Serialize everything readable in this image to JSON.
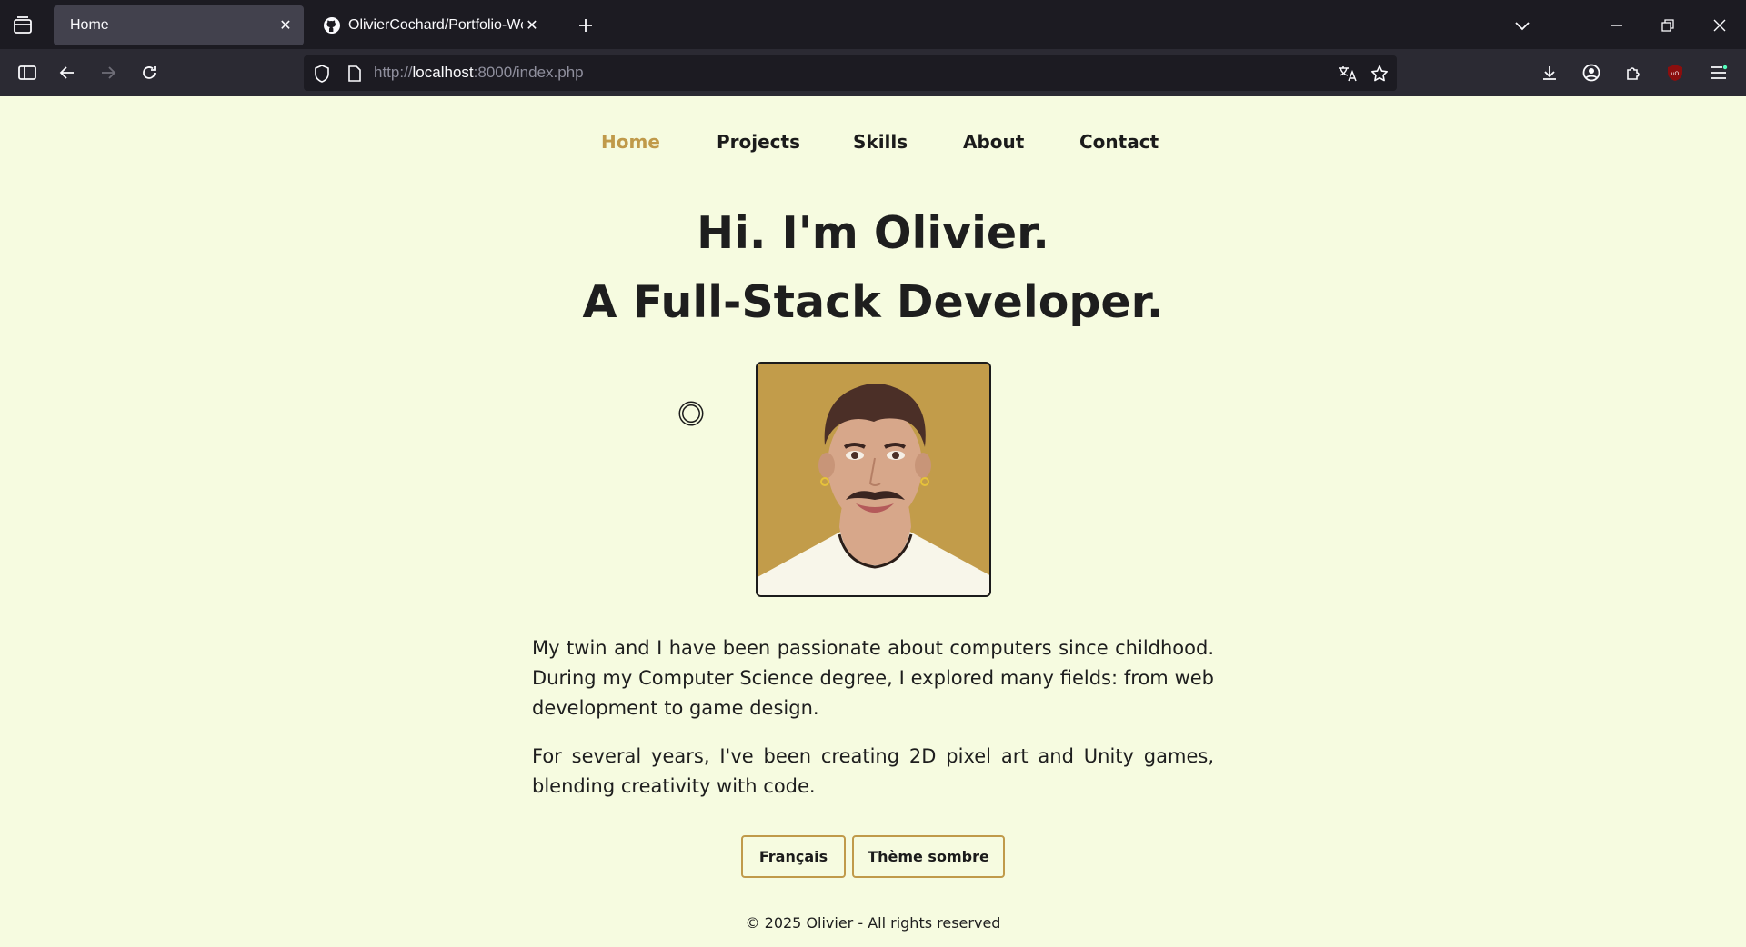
{
  "browser": {
    "tabs": [
      {
        "title": "Home",
        "active": true
      },
      {
        "title": "OlivierCochard/Portfolio-Websi",
        "active": false
      }
    ],
    "url_prefix": "http://",
    "url_host": "localhost",
    "url_rest": ":8000/index.php"
  },
  "nav": {
    "items": [
      "Home",
      "Projects",
      "Skills",
      "About",
      "Contact"
    ]
  },
  "hero": {
    "line1": "Hi. I'm Olivier.",
    "line2": "A Full-Stack Developer."
  },
  "bio": {
    "paragraph1": "My twin and I have been passionate about computers since childhood. During my Computer Science degree, I explored many fields: from web development to game design.",
    "paragraph2": "For several years, I've been creating 2D pixel art and Unity games, blending creativity with code."
  },
  "buttons": {
    "language": "Français",
    "theme": "Thème sombre"
  },
  "footer": {
    "text": "© 2025 Olivier - All rights reserved"
  },
  "colors": {
    "page_bg": "#f6fbe0",
    "accent": "#c09a4a",
    "avatar_bg": "#c29c4a",
    "text": "#1e1e1e"
  }
}
